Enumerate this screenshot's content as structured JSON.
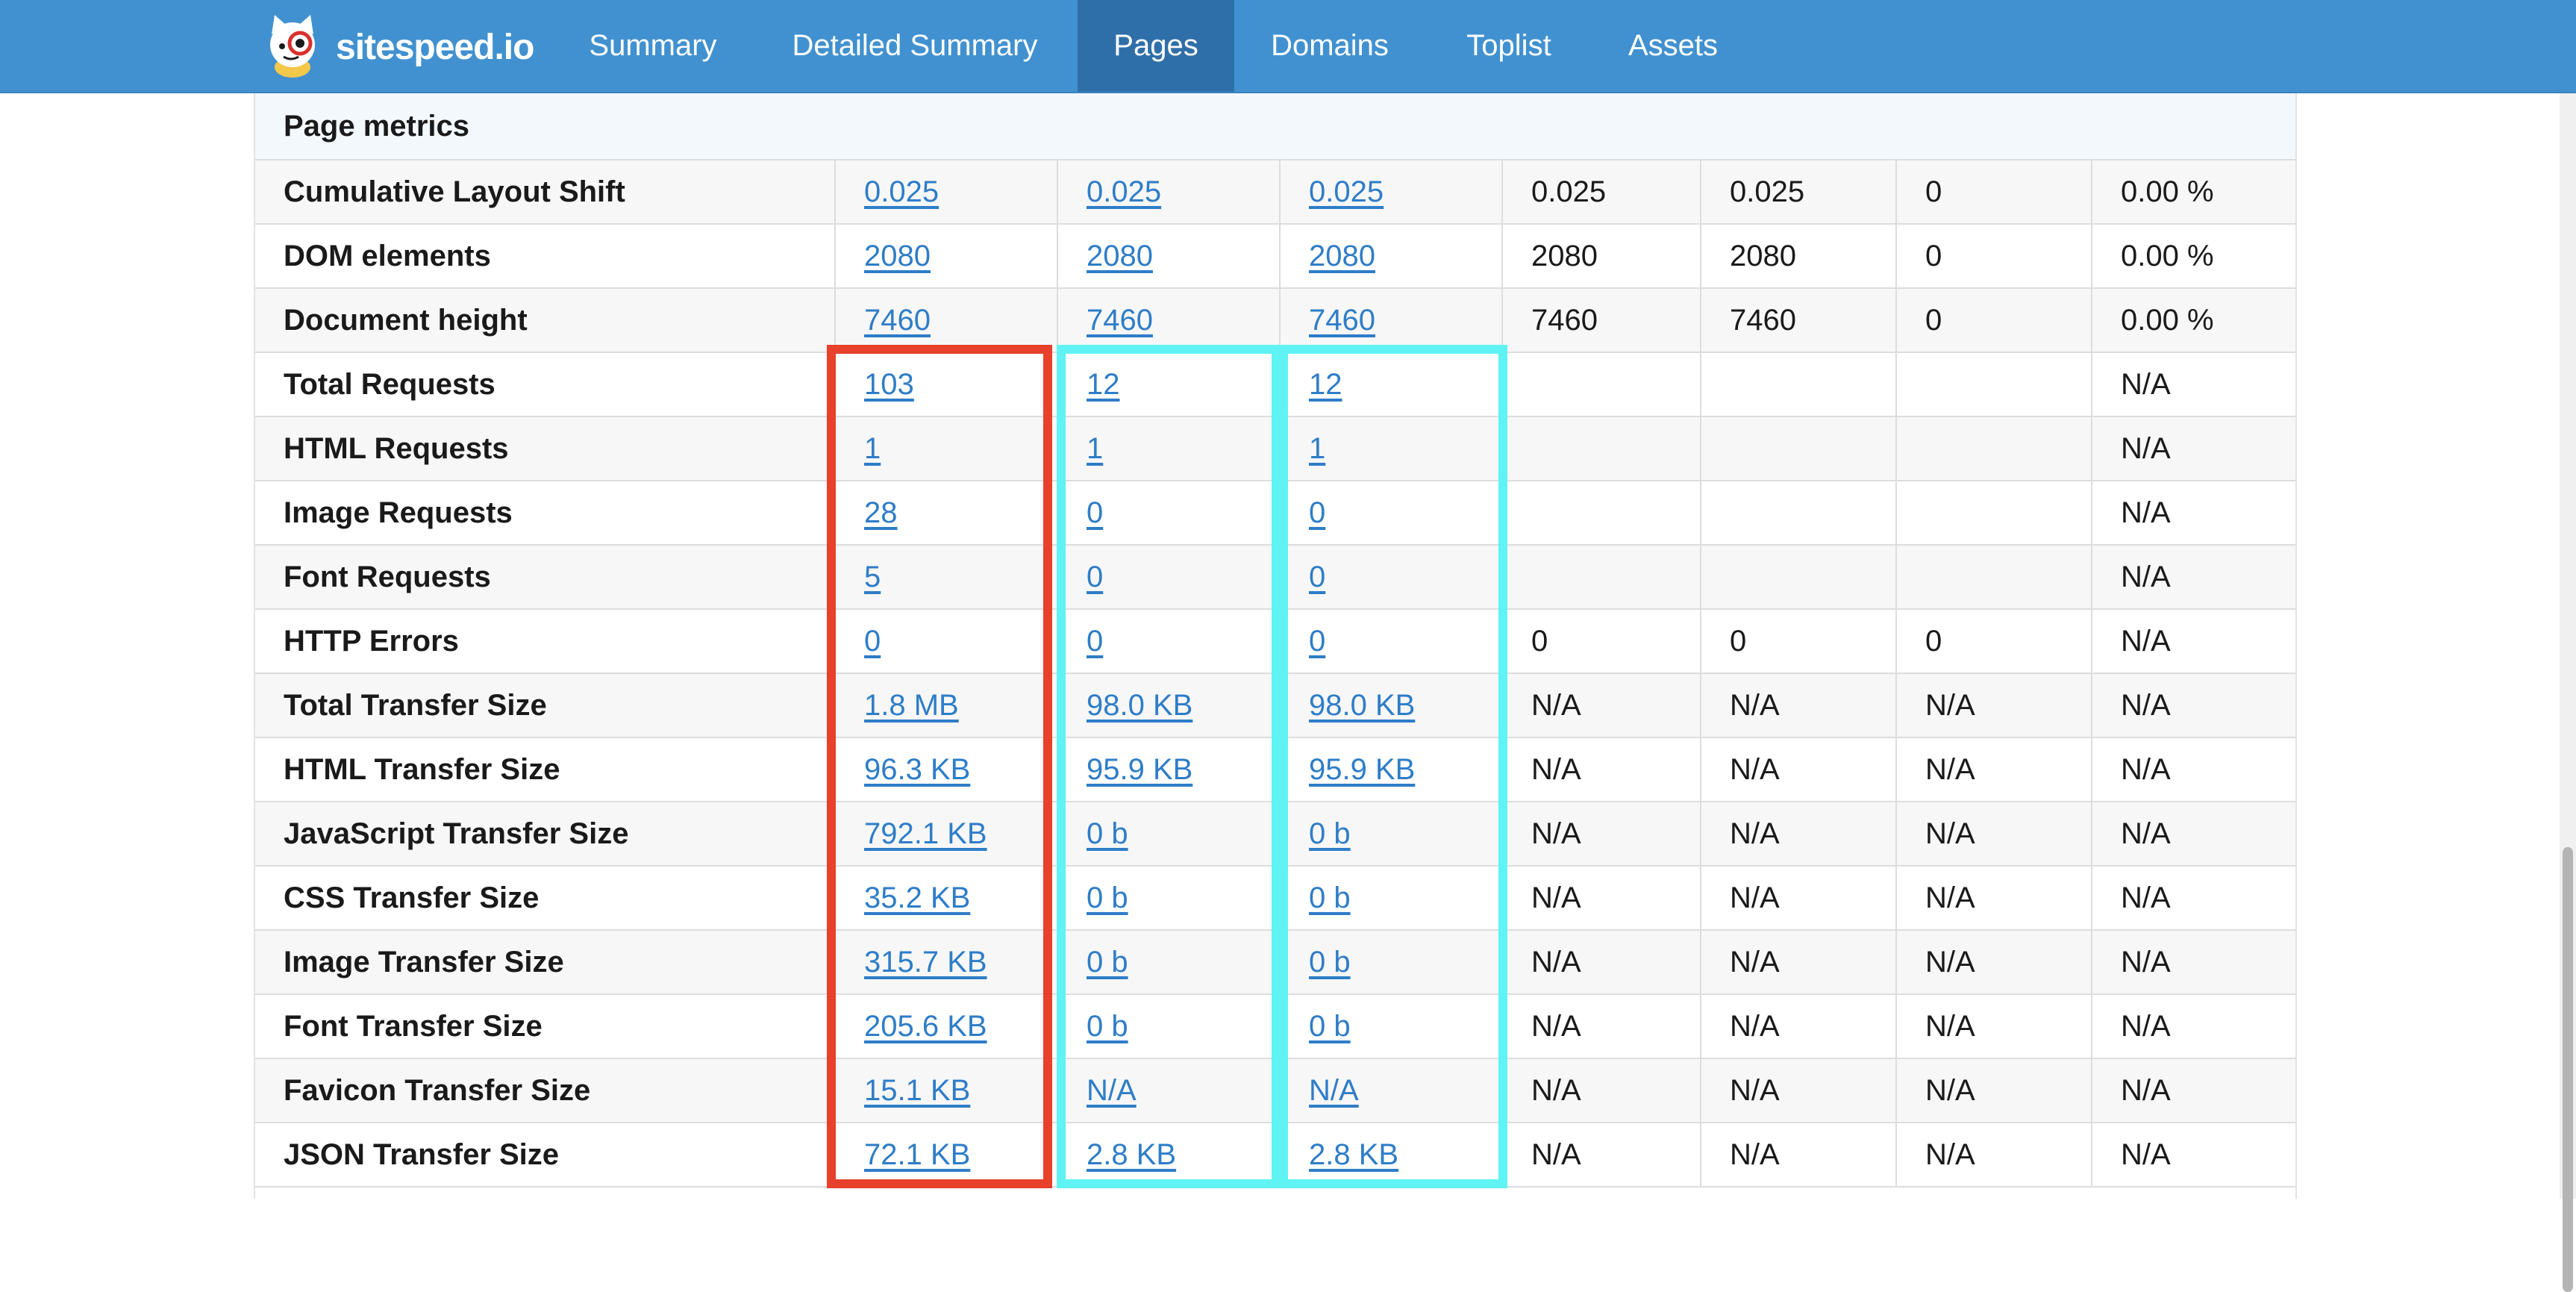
{
  "brand": {
    "name": "sitespeed.io"
  },
  "nav": [
    {
      "label": "Summary",
      "active": false
    },
    {
      "label": "Detailed Summary",
      "active": false
    },
    {
      "label": "Pages",
      "active": true
    },
    {
      "label": "Domains",
      "active": false
    },
    {
      "label": "Toplist",
      "active": false
    },
    {
      "label": "Assets",
      "active": false
    }
  ],
  "section": {
    "title": "Page metrics"
  },
  "rows": [
    {
      "label": "Cumulative Layout Shift",
      "cells": [
        "0.025",
        "0.025",
        "0.025",
        "0.025",
        "0.025",
        "0",
        "0.00 %"
      ]
    },
    {
      "label": "DOM elements",
      "cells": [
        "2080",
        "2080",
        "2080",
        "2080",
        "2080",
        "0",
        "0.00 %"
      ]
    },
    {
      "label": "Document height",
      "cells": [
        "7460",
        "7460",
        "7460",
        "7460",
        "7460",
        "0",
        "0.00 %"
      ]
    },
    {
      "label": "Total Requests",
      "cells": [
        "103",
        "12",
        "12",
        "",
        "",
        "",
        "N/A"
      ]
    },
    {
      "label": "HTML Requests",
      "cells": [
        "1",
        "1",
        "1",
        "",
        "",
        "",
        "N/A"
      ]
    },
    {
      "label": "Image Requests",
      "cells": [
        "28",
        "0",
        "0",
        "",
        "",
        "",
        "N/A"
      ]
    },
    {
      "label": "Font Requests",
      "cells": [
        "5",
        "0",
        "0",
        "",
        "",
        "",
        "N/A"
      ]
    },
    {
      "label": "HTTP Errors",
      "cells": [
        "0",
        "0",
        "0",
        "0",
        "0",
        "0",
        "N/A"
      ]
    },
    {
      "label": "Total Transfer Size",
      "cells": [
        "1.8 MB",
        "98.0 KB",
        "98.0 KB",
        "N/A",
        "N/A",
        "N/A",
        "N/A"
      ]
    },
    {
      "label": "HTML Transfer Size",
      "cells": [
        "96.3 KB",
        "95.9 KB",
        "95.9 KB",
        "N/A",
        "N/A",
        "N/A",
        "N/A"
      ]
    },
    {
      "label": "JavaScript Transfer Size",
      "cells": [
        "792.1 KB",
        "0 b",
        "0 b",
        "N/A",
        "N/A",
        "N/A",
        "N/A"
      ]
    },
    {
      "label": "CSS Transfer Size",
      "cells": [
        "35.2 KB",
        "0 b",
        "0 b",
        "N/A",
        "N/A",
        "N/A",
        "N/A"
      ]
    },
    {
      "label": "Image Transfer Size",
      "cells": [
        "315.7 KB",
        "0 b",
        "0 b",
        "N/A",
        "N/A",
        "N/A",
        "N/A"
      ]
    },
    {
      "label": "Font Transfer Size",
      "cells": [
        "205.6 KB",
        "0 b",
        "0 b",
        "N/A",
        "N/A",
        "N/A",
        "N/A"
      ]
    },
    {
      "label": "Favicon Transfer Size",
      "cells": [
        "15.1 KB",
        "N/A",
        "N/A",
        "N/A",
        "N/A",
        "N/A",
        "N/A"
      ]
    },
    {
      "label": "JSON Transfer Size",
      "cells": [
        "72.1 KB",
        "2.8 KB",
        "2.8 KB",
        "N/A",
        "N/A",
        "N/A",
        "N/A"
      ]
    }
  ],
  "colors": {
    "navbar": "#4191d0",
    "nav_active": "#2f6fa9",
    "link": "#2e7dc8",
    "highlight_red": "#e7402b",
    "highlight_cyan": "#5ff3f4"
  },
  "icons": {
    "logo": "cat-mascot-icon"
  }
}
